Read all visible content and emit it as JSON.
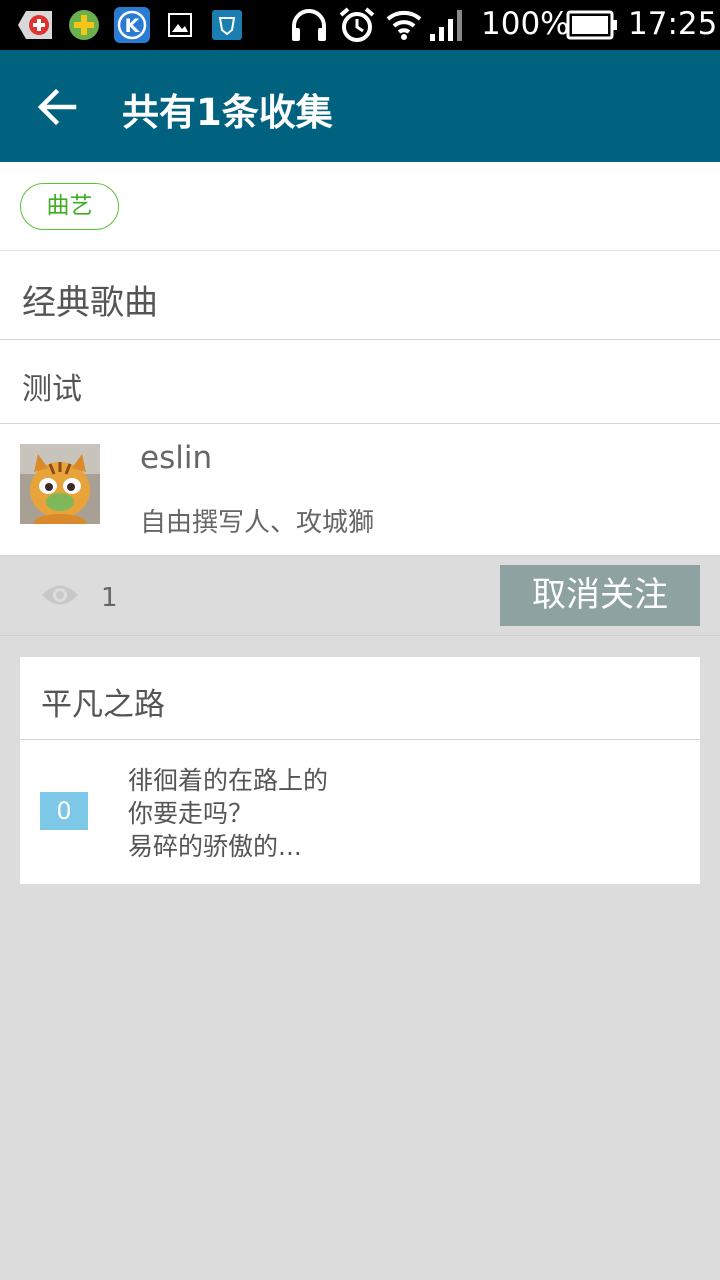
{
  "status_bar": {
    "battery": "100%",
    "time": "17:25",
    "icons": [
      "app-red-icon",
      "app-green-icon",
      "kugou-icon",
      "image-icon",
      "shield-app-icon",
      "headphones-icon",
      "alarm-icon",
      "wifi-icon",
      "signal-icon",
      "battery-icon"
    ]
  },
  "app_bar": {
    "title": "共有1条收集",
    "back_icon": "arrow-left-icon"
  },
  "tag": {
    "label": "曲艺",
    "color": "#3fae23"
  },
  "collection": {
    "title": "经典歌曲",
    "description": "测试"
  },
  "user": {
    "name": "eslin",
    "bio": "自由撰写人、攻城獅"
  },
  "stats": {
    "view_count": "1",
    "unfollow_label": "取消关注"
  },
  "item": {
    "title": "平凡之路",
    "badge": "0",
    "excerpt_line1": "徘徊着的在路上的",
    "excerpt_line2": "你要走吗？",
    "excerpt_line3": "易碎的骄傲的..."
  },
  "colors": {
    "app_bar": "#00627f",
    "unfollow_button": "#8fa2a2",
    "badge": "#7cc8e6"
  }
}
